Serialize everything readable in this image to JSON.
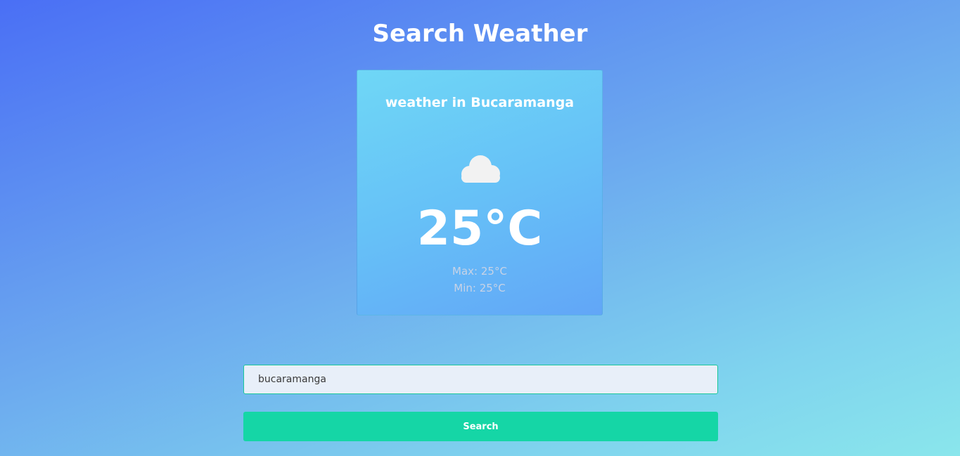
{
  "header": {
    "title": "Search Weather"
  },
  "weather_card": {
    "title": "weather in Bucaramanga",
    "icon": "cloud-icon",
    "temperature": "25°C",
    "max": "Max: 25°C",
    "min": "Min: 25°C"
  },
  "search": {
    "value": "bucaramanga",
    "button_label": "Search"
  },
  "colors": {
    "button": "#15d6a6",
    "input_border": "#1bc79a",
    "input_background": "#e8eff9"
  }
}
